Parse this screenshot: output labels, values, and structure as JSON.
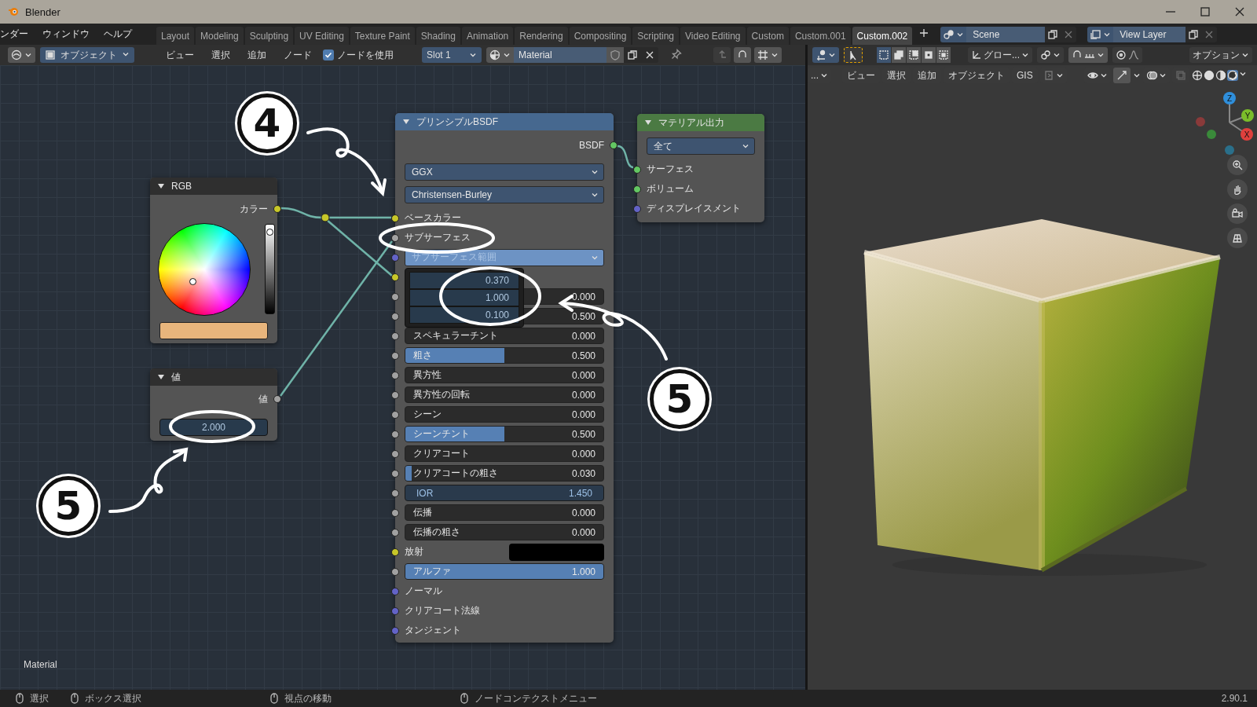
{
  "window": {
    "title": "Blender"
  },
  "menu": [
    "ンダー",
    "ウィンドウ",
    "ヘルプ"
  ],
  "workspace_tabs": [
    {
      "label": "Layout",
      "selected": false
    },
    {
      "label": "Modeling",
      "selected": false
    },
    {
      "label": "Sculpting",
      "selected": false
    },
    {
      "label": "UV Editing",
      "selected": false
    },
    {
      "label": "Texture Paint",
      "selected": false
    },
    {
      "label": "Shading",
      "selected": false
    },
    {
      "label": "Animation",
      "selected": false
    },
    {
      "label": "Rendering",
      "selected": false
    },
    {
      "label": "Compositing",
      "selected": false
    },
    {
      "label": "Scripting",
      "selected": false
    },
    {
      "label": "Video Editing",
      "selected": false
    },
    {
      "label": "Custom",
      "selected": false
    },
    {
      "label": "Custom.001",
      "selected": false
    },
    {
      "label": "Custom.002",
      "selected": true
    }
  ],
  "scene": "Scene",
  "view_layer": "View Layer",
  "node_header": {
    "mode": "オブジェクト",
    "menus": [
      "ビュー",
      "選択",
      "追加",
      "ノード"
    ],
    "use_nodes": {
      "label": "ノードを使用",
      "checked": true
    },
    "slot": "Slot 1",
    "material": "Material"
  },
  "viewport_header": {
    "transform": "グロー...",
    "options": "オプション",
    "mode": "...",
    "menus": [
      "ビュー",
      "選択",
      "追加",
      "オブジェクト",
      "GIS"
    ]
  },
  "rgb_node": {
    "title": "RGB",
    "output": "カラー",
    "color": "#e8b57c",
    "brightness": {
      "level": 0.95
    }
  },
  "value_node": {
    "title": "値",
    "output": "値",
    "value": "2.000"
  },
  "bsdf_node": {
    "title": "プリンシプルBSDF",
    "output": "BSDF",
    "distribution": "GGX",
    "subsurface_method": "Christensen-Burley",
    "popup": [
      "0.370",
      "1.000",
      "0.100"
    ],
    "rows": [
      {
        "kind": "socket",
        "socket": {
          "color": "#c7c729"
        },
        "label": "ベースカラー"
      },
      {
        "kind": "socket",
        "socket": {
          "color": "#a1a1a1"
        },
        "label": "サブサーフェス"
      },
      {
        "kind": "dropdown",
        "socket": {
          "color": "#6363c7"
        },
        "label": "サブサーフェス範囲",
        "expanded": true
      },
      {
        "kind": "hidden",
        "socket": {
          "color": "#c7c729"
        }
      },
      {
        "kind": "number",
        "socket": {
          "color": "#a1a1a1"
        },
        "value": "0.000"
      },
      {
        "kind": "number",
        "socket": {
          "color": "#a1a1a1"
        },
        "value": "0.500"
      },
      {
        "kind": "slider",
        "socket": {
          "color": "#a1a1a1"
        },
        "label": "スペキュラーチント",
        "value": "0.000",
        "level": 0
      },
      {
        "kind": "slider",
        "socket": {
          "color": "#a1a1a1"
        },
        "label": "粗さ",
        "value": "0.500",
        "level": 0.5
      },
      {
        "kind": "slider",
        "socket": {
          "color": "#a1a1a1"
        },
        "label": "異方性",
        "value": "0.000",
        "level": 0
      },
      {
        "kind": "slider",
        "socket": {
          "color": "#a1a1a1"
        },
        "label": "異方性の回転",
        "value": "0.000",
        "level": 0
      },
      {
        "kind": "slider",
        "socket": {
          "color": "#a1a1a1"
        },
        "label": "シーン",
        "value": "0.000",
        "level": 0
      },
      {
        "kind": "slider",
        "socket": {
          "color": "#a1a1a1"
        },
        "label": "シーンチント",
        "value": "0.500",
        "level": 0.5
      },
      {
        "kind": "slider",
        "socket": {
          "color": "#a1a1a1"
        },
        "label": "クリアコート",
        "value": "0.000",
        "level": 0
      },
      {
        "kind": "slider",
        "socket": {
          "color": "#a1a1a1"
        },
        "label": "クリアコートの粗さ",
        "value": "0.030",
        "level": 0.03
      },
      {
        "kind": "field",
        "socket": {
          "color": "#a1a1a1"
        },
        "label": "IOR",
        "value": "1.450"
      },
      {
        "kind": "slider",
        "socket": {
          "color": "#a1a1a1"
        },
        "label": "伝播",
        "value": "0.000",
        "level": 0
      },
      {
        "kind": "slider",
        "socket": {
          "color": "#a1a1a1"
        },
        "label": "伝播の粗さ",
        "value": "0.000",
        "level": 0
      },
      {
        "kind": "color",
        "socket": {
          "color": "#c7c729"
        },
        "label": "放射",
        "color": "#000000"
      },
      {
        "kind": "slider",
        "socket": {
          "color": "#a1a1a1"
        },
        "label": "アルファ",
        "value": "1.000",
        "level": 1
      },
      {
        "kind": "socket",
        "socket": {
          "color": "#6363c7"
        },
        "label": "ノーマル"
      },
      {
        "kind": "socket",
        "socket": {
          "color": "#6363c7"
        },
        "label": "クリアコート法線"
      },
      {
        "kind": "socket",
        "socket": {
          "color": "#6363c7"
        },
        "label": "タンジェント"
      }
    ]
  },
  "output_node": {
    "title": "マテリアル出力",
    "target": "全て",
    "inputs": [
      {
        "label": "サーフェス",
        "socket": {
          "color": "#63c763"
        }
      },
      {
        "label": "ボリューム",
        "socket": {
          "color": "#63c763"
        }
      },
      {
        "label": "ディスプレイスメント",
        "socket": {
          "color": "#6363c7"
        }
      }
    ]
  },
  "annotations": [
    "4",
    "5",
    "5"
  ],
  "canvas_label": "Material",
  "gizmo": [
    "Z",
    "Y",
    "X"
  ],
  "status_bar": {
    "hints": [
      "選択",
      "ボックス選択",
      "視点の移動",
      "ノードコンテクストメニュー"
    ],
    "version": "2.90.1"
  }
}
